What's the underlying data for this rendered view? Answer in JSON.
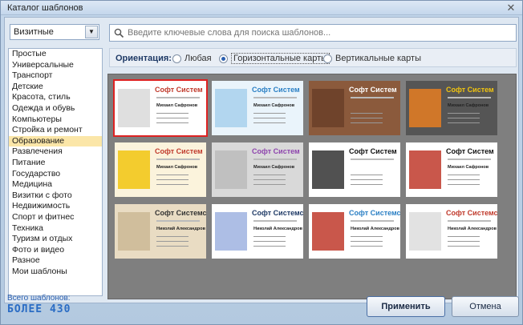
{
  "window": {
    "title": "Каталог шаблонов",
    "close_glyph": "✕"
  },
  "category_select": {
    "value": "Визитные",
    "arrow_glyph": "▼"
  },
  "categories": [
    "Простые",
    "Универсальные",
    "Транспорт",
    "Детские",
    "Красота, стиль",
    "Одежда и обувь",
    "Компьютеры",
    "Стройка и ремонт",
    "Образование",
    "Развлечения",
    "Питание",
    "Государство",
    "Медицина",
    "Визитки с фото",
    "Недвижимость",
    "Спорт и фитнес",
    "Техника",
    "Туризм и отдых",
    "Фото и видео",
    "Разное",
    "Мои шаблоны"
  ],
  "selected_category": "Образование",
  "search": {
    "placeholder": "Введите ключевые слова для поиска шаблонов..."
  },
  "orientation": {
    "label": "Ориентация:",
    "options": [
      "Любая",
      "Горизонтальные карты",
      "Вертикальные карты"
    ],
    "selected": "Горизонтальные карты"
  },
  "cards": [
    {
      "title": "Софт Систем",
      "name": "Михаил Сафронов",
      "bg": "#ffffff",
      "title_color": "#c0392b",
      "accent": "#d9d9d9",
      "selected": true
    },
    {
      "title": "Софт Систем",
      "name": "Михаил Сафронов",
      "bg": "#eaf4fb",
      "title_color": "#2a7fc4",
      "accent": "#a8d0ec",
      "selected": false
    },
    {
      "title": "Софт Систем",
      "name": "",
      "bg": "#8b5a3c",
      "title_color": "#ffffff",
      "accent": "#6a3f28",
      "selected": false
    },
    {
      "title": "Софт Систем",
      "name": "Михаил Сафронов",
      "bg": "#555555",
      "title_color": "#f1c40f",
      "accent": "#e67e22",
      "selected": false
    },
    {
      "title": "Софт Систем",
      "name": "Михаил Сафронов",
      "bg": "#fbf3dc",
      "title_color": "#c0392b",
      "accent": "#f1c40f",
      "selected": false
    },
    {
      "title": "Софт Систем",
      "name": "Михаил Сафронов",
      "bg": "#d9d9d9",
      "title_color": "#8e44ad",
      "accent": "#bbbbbb",
      "selected": false
    },
    {
      "title": "Софт Систем",
      "name": "",
      "bg": "#ffffff",
      "title_color": "#111111",
      "accent": "#333333",
      "selected": false
    },
    {
      "title": "Софт Систем",
      "name": "Михаил Сафронов",
      "bg": "#ffffff",
      "title_color": "#111111",
      "accent": "#c0392b",
      "selected": false
    },
    {
      "title": "Софт Системс",
      "name": "Николай Александров",
      "bg": "#e9dcc3",
      "title_color": "#333333",
      "accent": "#cbb995",
      "selected": false
    },
    {
      "title": "Софт Системс",
      "name": "Николай Александров",
      "bg": "#ffffff",
      "title_color": "#1f3a66",
      "accent": "#9fb3e0",
      "selected": false
    },
    {
      "title": "Софт Системс",
      "name": "Николай Александров",
      "bg": "#ffffff",
      "title_color": "#2a7fc4",
      "accent": "#c0392b",
      "selected": false
    },
    {
      "title": "Софт Системс",
      "name": "Николай Александров",
      "bg": "#ffffff",
      "title_color": "#c0392b",
      "accent": "#dddddd",
      "selected": false
    }
  ],
  "footer": {
    "label": "Всего шаблонов:",
    "count": "БОЛЕЕ 430"
  },
  "buttons": {
    "apply": "Применить",
    "cancel": "Отмена"
  }
}
